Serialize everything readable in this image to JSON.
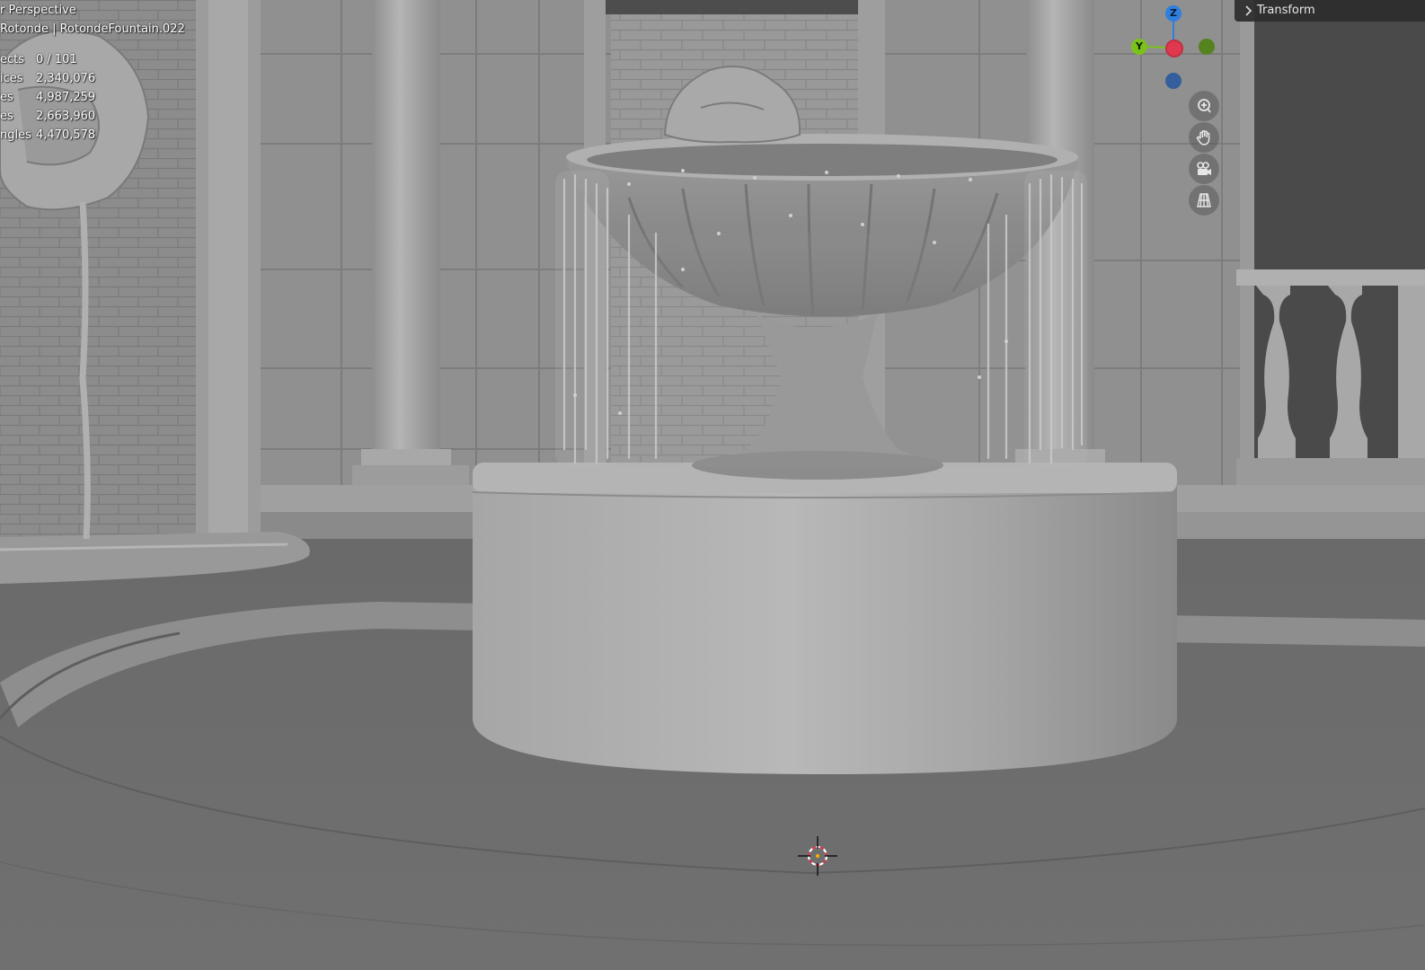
{
  "viewport": {
    "view_mode": "User Perspective",
    "view_mode_display": "r Perspective",
    "collection_line": "Rotonde | RotondeFountain.022",
    "stats": [
      {
        "label": "Objects",
        "label_display": "ects",
        "value": "0 / 101"
      },
      {
        "label": "Vertices",
        "label_display": "ices",
        "value": "2,340,076"
      },
      {
        "label": "Edges",
        "label_display": "es",
        "value": "4,987,259"
      },
      {
        "label": "Faces",
        "label_display": "es",
        "value": "2,663,960"
      },
      {
        "label": "Triangles",
        "label_display": "ngles",
        "value": "4,470,578"
      }
    ]
  },
  "gizmo": {
    "z_label": "Z",
    "y_label": "Y",
    "colors": {
      "x": "#e0384f",
      "y": "#7ac21b",
      "z": "#2e7fdf",
      "neg_z": "#345e9c",
      "neg_y": "#56821f"
    }
  },
  "nav_buttons": [
    {
      "name": "zoom",
      "icon": "zoom-in-icon"
    },
    {
      "name": "pan",
      "icon": "hand-icon"
    },
    {
      "name": "camera",
      "icon": "camera-icon"
    },
    {
      "name": "perspective-toggle",
      "icon": "grid-icon"
    }
  ],
  "sidebar": {
    "panel_label": "Transform",
    "collapsed": true
  },
  "scene": {
    "description_colors": {
      "floor": "#6a6a6a",
      "wall": "#8e8e8e",
      "stone": "#a4a4a4"
    }
  }
}
